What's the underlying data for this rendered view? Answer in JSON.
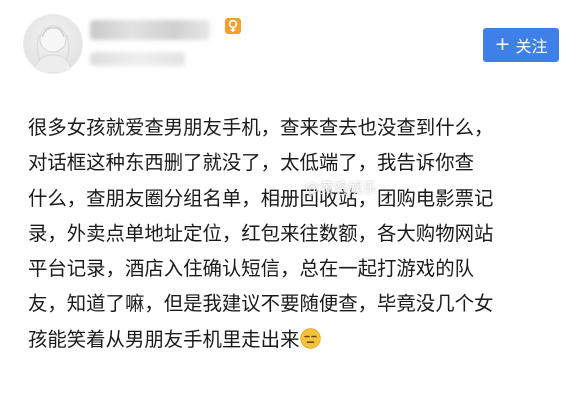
{
  "header": {
    "follow_button": {
      "icon": "plus-icon",
      "plus_glyph": "+",
      "label": "关注",
      "color": "#3f7fe8"
    },
    "gender_icon": "female-icon",
    "gender_color": "#f2a02c"
  },
  "post": {
    "lines": [
      "很多女孩就爱查男朋友手机，查来查去也没查到什么，",
      "对话框这种东西删了就没了，太低端了，我告诉你查",
      "什么，查朋友圈分组名单，相册回收站，团购电影票记",
      "录，外卖点单地址定位，红包来往数额，各大购物网站",
      "平台记录，酒店入住确认短信，总在一起打游戏的队",
      "友，知道了嘛，但是我建议不要随便查，毕竟没几个女",
      "孩能笑着从男朋友手机里走出来"
    ],
    "trailing_emoji": "unamused-face-icon"
  },
  "watermark": {
    "text": "@黄鸡娱乐"
  }
}
